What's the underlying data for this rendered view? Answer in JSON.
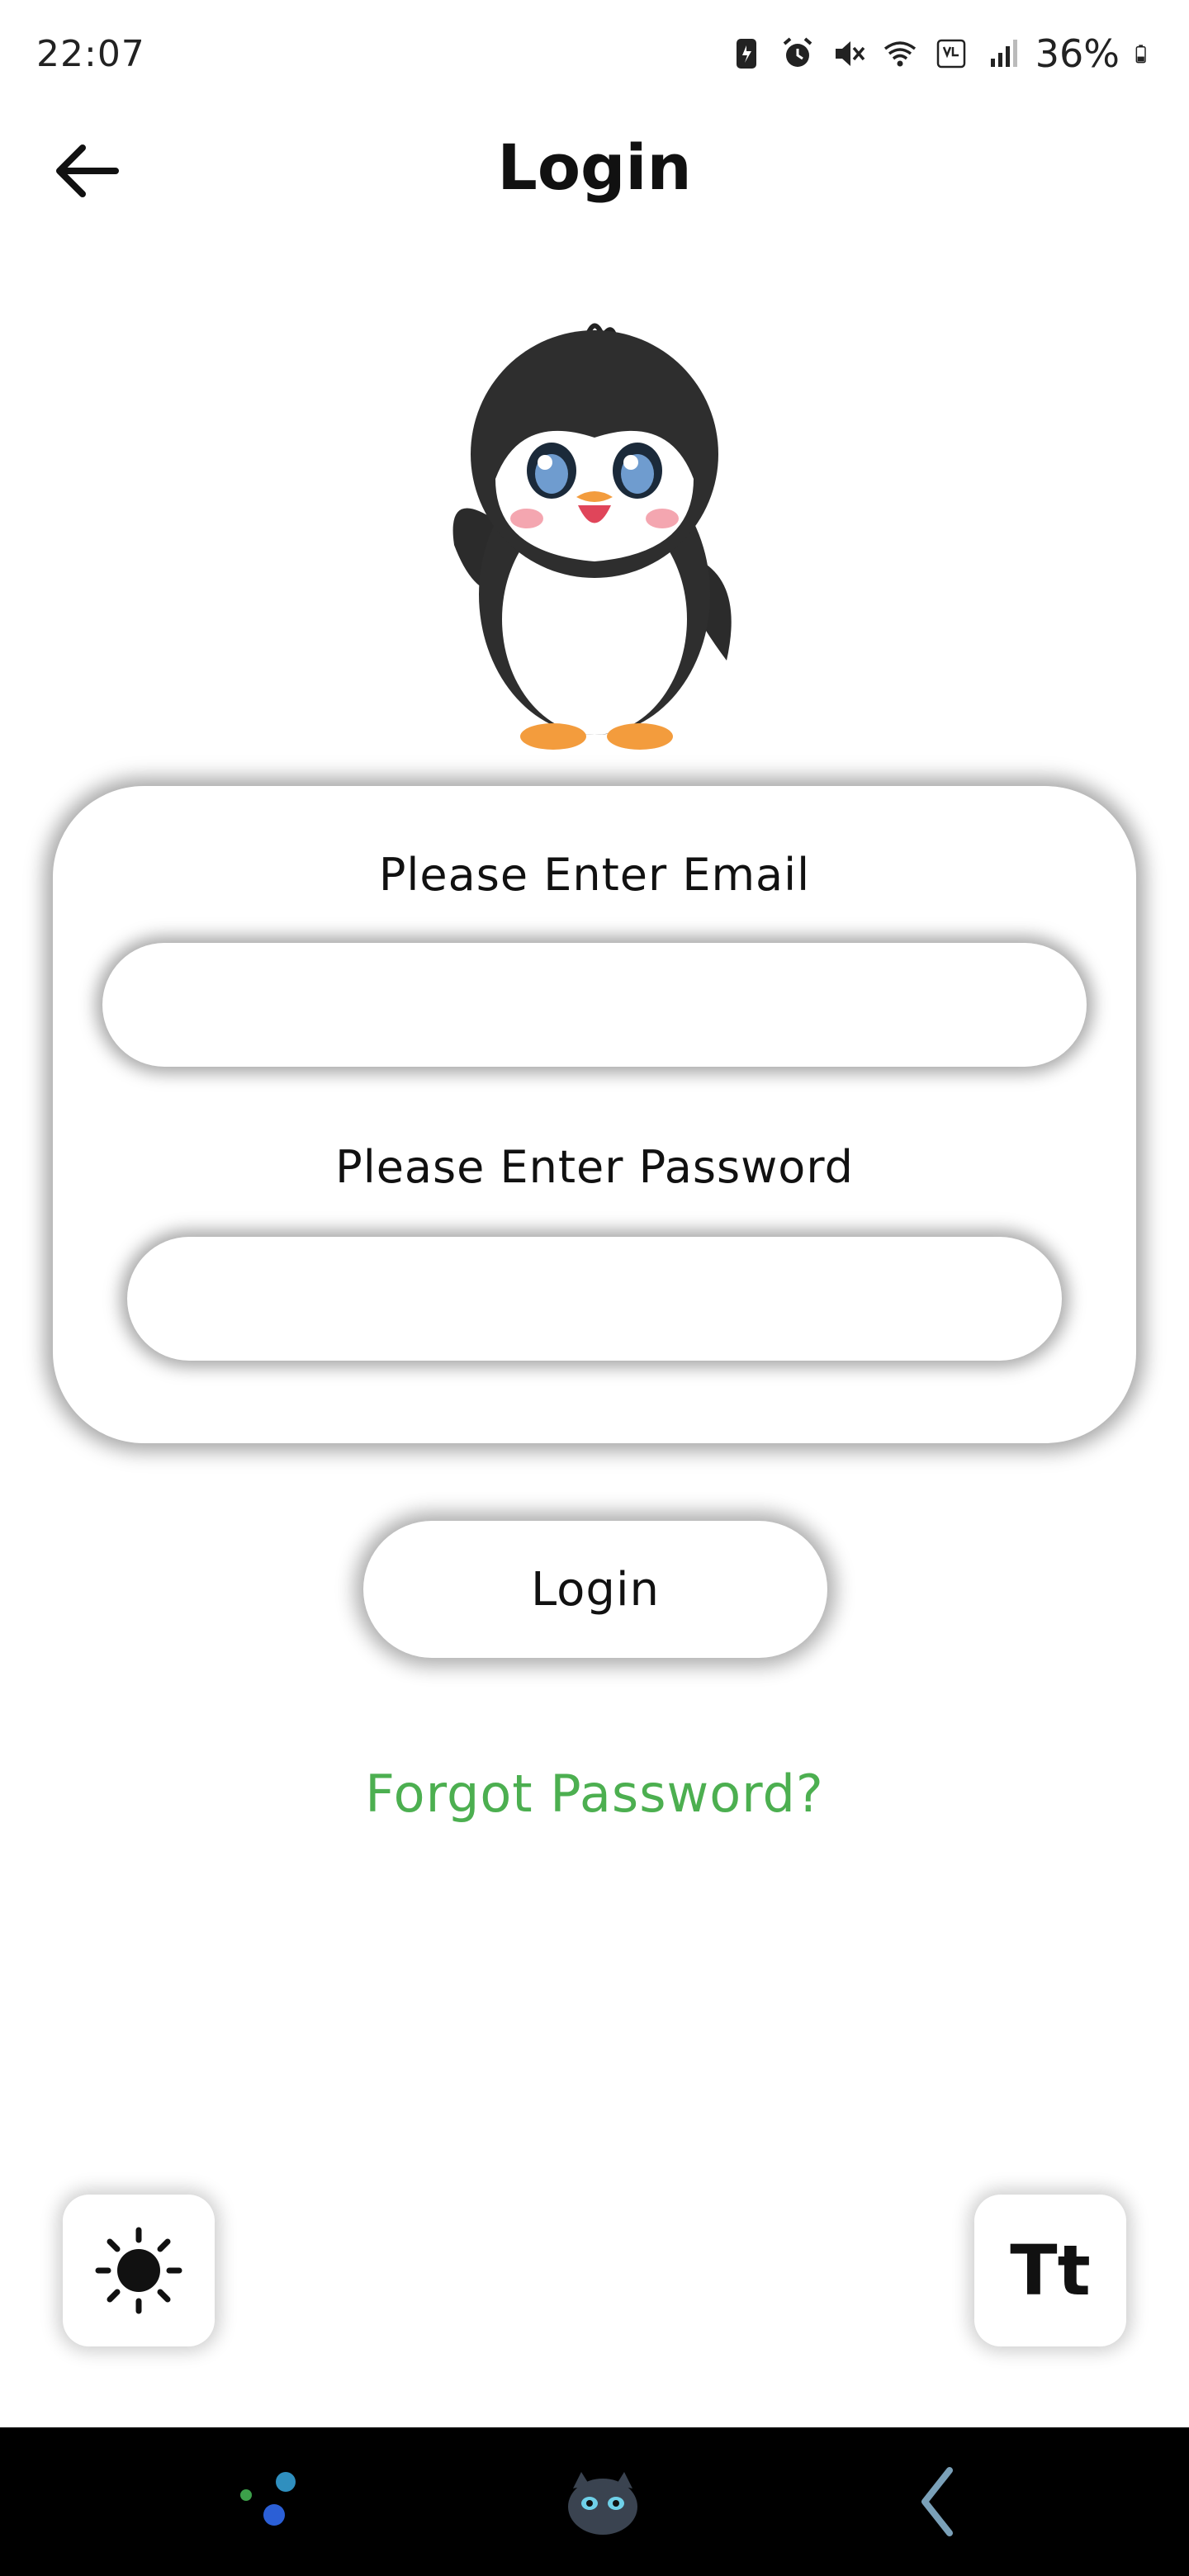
{
  "status_bar": {
    "time": "22:07",
    "battery": "36%",
    "icons": [
      "sim-alert-icon",
      "alarm-icon",
      "mute-icon",
      "wifi-icon",
      "volte-icon",
      "signal-icon",
      "battery-icon"
    ]
  },
  "app_bar": {
    "title": "Login",
    "back_icon": "arrow-left-icon"
  },
  "form": {
    "email_label": "Please Enter Email",
    "email_value": "",
    "password_label": "Please Enter Password",
    "password_value": ""
  },
  "actions": {
    "login_label": "Login",
    "forgot_label": "Forgot Password?"
  },
  "tools": {
    "theme_icon": "sun-icon",
    "font_label": "Tt"
  },
  "colors": {
    "accent_green": "#4caf50",
    "text": "#111111",
    "background": "#ffffff",
    "nav_bar": "#000000"
  }
}
